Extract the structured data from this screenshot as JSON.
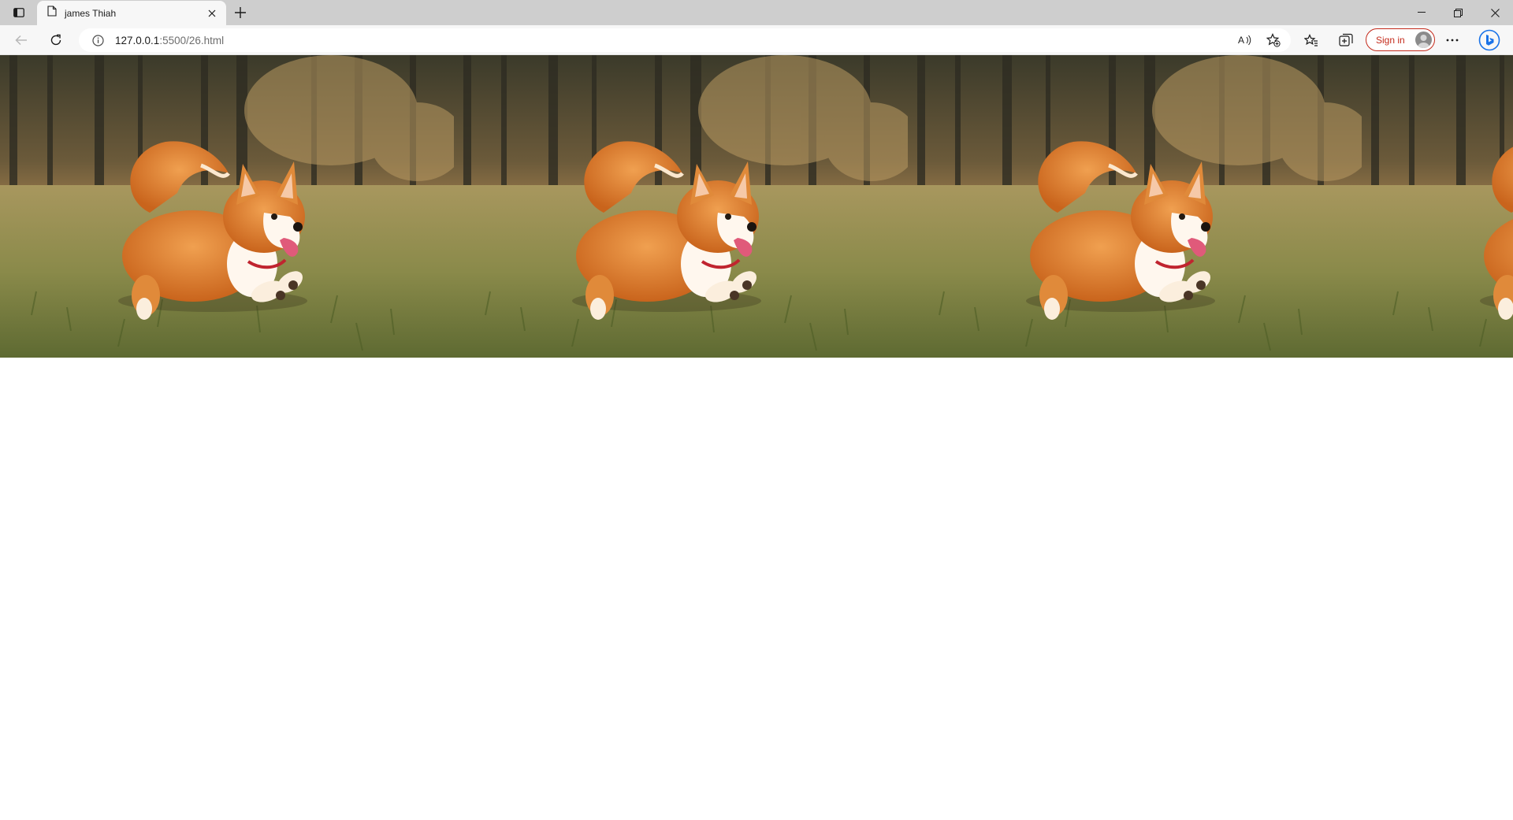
{
  "browser": {
    "tab": {
      "title": "james Thiah"
    },
    "address": {
      "url_host": "127.0.0.1",
      "url_rest": ":5500/26.html"
    },
    "signin_label": "Sign in"
  },
  "page": {
    "images": [
      {
        "subject": "corgi running on grass"
      },
      {
        "subject": "corgi running on grass"
      },
      {
        "subject": "corgi running on grass"
      },
      {
        "subject": "corgi running on grass"
      }
    ]
  },
  "icons": [
    "sidebar-icon",
    "page-icon",
    "close-icon",
    "plus-icon",
    "minimize-icon",
    "restore-icon",
    "back-icon",
    "refresh-icon",
    "info-icon",
    "read-aloud-icon",
    "add-favorite-icon",
    "favorites-icon",
    "collections-icon",
    "more-icon",
    "bing-icon"
  ],
  "colors": {
    "accent": "#c42b1c",
    "bing": "#1a73e8",
    "tabbar": "#cecece",
    "toolbar": "#f7f7f7"
  }
}
